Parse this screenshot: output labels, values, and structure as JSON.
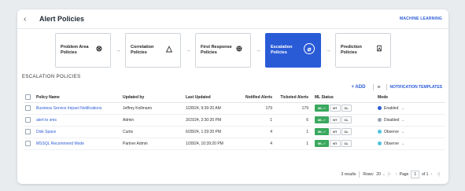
{
  "header": {
    "title": "Alert Policies",
    "ml_link": "MACHINE LEARNING",
    "back_icon": "chevron-left-icon"
  },
  "steps": [
    {
      "label": "Problem Area Policies",
      "icon": "shield-icon",
      "glyph": "⊗"
    },
    {
      "label": "Correlation Policies",
      "icon": "triangle-icon",
      "glyph": "△"
    },
    {
      "label": "First Response Policies",
      "icon": "plus-circle-icon",
      "glyph": "⊕"
    },
    {
      "label": "Escalation Policies",
      "icon": "compass-icon",
      "glyph": "⌀"
    },
    {
      "label": "Prediction Policies",
      "icon": "tools-icon",
      "glyph": "⍓"
    }
  ],
  "section_title": "ESCALATION POLICIES",
  "toolbar": {
    "add": "+  ADD",
    "templates": "NOTIFICATION TEMPLATES"
  },
  "columns": [
    "Policy Name",
    "Updated by",
    "Last Updated",
    "Notified Alerts",
    "Ticketed Alerts",
    "ML Status",
    "Mode"
  ],
  "rows": [
    {
      "name": "Business Service Impact Notifications",
      "updated_by": "Jeffrey Kollmann",
      "last_updated": "1/28/24, 9:39:20 AM",
      "notified": "179",
      "ticketed": "179",
      "ml": [
        "ML ✓",
        "NT",
        "CL"
      ],
      "mode": "Enabled",
      "mode_color": "#2a5bd7"
    },
    {
      "name": "alert to sms",
      "updated_by": "Admin",
      "last_updated": "3/15/24, 2:30:20 PM",
      "notified": "1",
      "ticketed": "6",
      "ml": [
        "ML ✓",
        "NT",
        "CL"
      ],
      "mode": "Disabled",
      "mode_color": "#9aa5b1"
    },
    {
      "name": "Disk Space",
      "updated_by": "Curtis",
      "last_updated": "6/28/24, 1:29:20 PM",
      "notified": "4",
      "ticketed": "1",
      "ml": [
        "ML ✓",
        "NT",
        "CL"
      ],
      "mode": "Observe",
      "mode_color": "#4fc3d9"
    },
    {
      "name": "MSSQL Recommend Mode",
      "updated_by": "Partner Admin",
      "last_updated": "1/28/24, 10:39:20 PM",
      "notified": "4",
      "ticketed": "1",
      "ml": [
        "ML ✓",
        "NT",
        "CL"
      ],
      "mode": "Observe",
      "mode_color": "#4fc3d9"
    }
  ],
  "footer": {
    "results": "3 results",
    "rows_label": "Rows:",
    "rows_value": "20",
    "page_label": "Page",
    "page_value": "1",
    "of": "of 1"
  }
}
